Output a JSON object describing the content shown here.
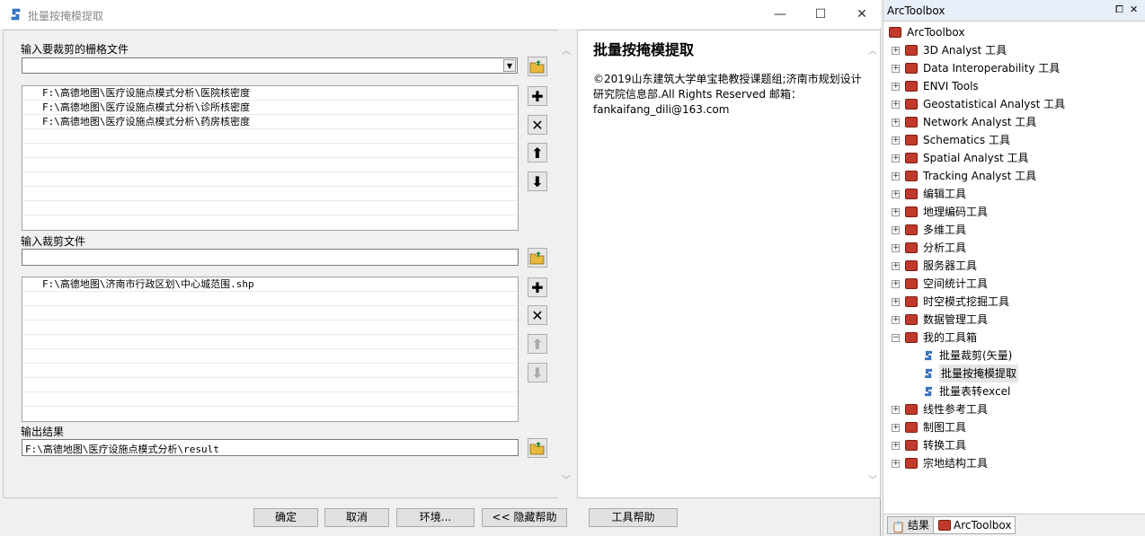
{
  "window": {
    "title": "批量按掩模提取",
    "minimize": "—",
    "maximize": "☐",
    "close": "✕"
  },
  "form": {
    "input_raster_label": "输入要裁剪的栅格文件",
    "input_raster_value": "",
    "input_raster_list": [
      "F:\\高德地图\\医疗设施点模式分析\\医院核密度",
      "F:\\高德地图\\医疗设施点模式分析\\诊所核密度",
      "F:\\高德地图\\医疗设施点模式分析\\药房核密度"
    ],
    "clip_file_label": "输入裁剪文件",
    "clip_file_value": "",
    "clip_file_list": [
      "F:\\高德地图\\济南市行政区划\\中心城范围.shp"
    ],
    "output_label": "输出结果",
    "output_value": "F:\\高德地图\\医疗设施点模式分析\\result"
  },
  "help": {
    "title": "批量按掩模提取",
    "body": "©2019山东建筑大学单宝艳教授课题组;济南市规划设计研究院信息部.All Rights Reserved 邮箱：fankaifang_dili@163.com"
  },
  "buttons": {
    "ok": "确定",
    "cancel": "取消",
    "environments": "环境...",
    "hide_help": "<< 隐藏帮助",
    "tool_help": "工具帮助"
  },
  "toolbox": {
    "header": "ArcToolbox",
    "pin": "⧠",
    "close": "✕",
    "root": "ArcToolbox",
    "items": [
      "3D Analyst 工具",
      "Data Interoperability 工具",
      "ENVI Tools",
      "Geostatistical Analyst 工具",
      "Network Analyst 工具",
      "Schematics 工具",
      "Spatial Analyst 工具",
      "Tracking Analyst 工具",
      "编辑工具",
      "地理编码工具",
      "多维工具",
      "分析工具",
      "服务器工具",
      "空间统计工具",
      "时空模式挖掘工具",
      "数据管理工具",
      "我的工具箱"
    ],
    "my_tools": [
      "批量裁剪(矢量)",
      "批量按掩模提取",
      "批量表转excel"
    ],
    "items_after": [
      "线性参考工具",
      "制图工具",
      "转换工具",
      "宗地结构工具"
    ],
    "tabs": [
      "结果",
      "ArcToolbox"
    ]
  }
}
